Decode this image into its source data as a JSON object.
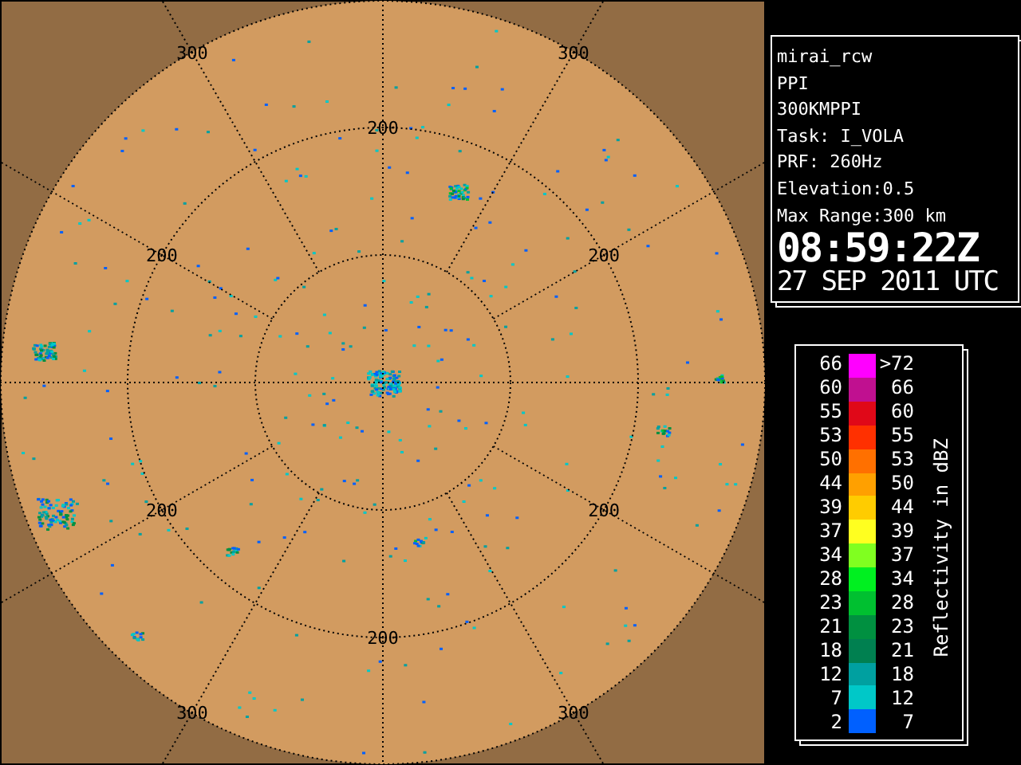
{
  "radar": {
    "ring_200_labels": [
      "200",
      "200",
      "200",
      "200",
      "200",
      "200"
    ],
    "ring_300_labels": [
      "300",
      "300",
      "300",
      "300"
    ]
  },
  "info": {
    "lines": [
      "mirai_rcw",
      "PPI",
      "300KMPPI",
      "Task: I_VOLA",
      "PRF: 260Hz",
      "Elevation:0.5",
      "Max Range:300 km"
    ],
    "time": "08:59:22Z",
    "date": "27 SEP 2011 UTC"
  },
  "legend": {
    "title": "Reflectivity in dBZ",
    "bins": [
      {
        "low": "66",
        "high": ">72",
        "color": "#ff00ff"
      },
      {
        "low": "60",
        "high": "66",
        "color": "#c01090"
      },
      {
        "low": "55",
        "high": "60",
        "color": "#e00818"
      },
      {
        "low": "53",
        "high": "55",
        "color": "#ff3000"
      },
      {
        "low": "50",
        "high": "53",
        "color": "#ff7000"
      },
      {
        "low": "44",
        "high": "50",
        "color": "#ffa000"
      },
      {
        "low": "39",
        "high": "44",
        "color": "#ffcc00"
      },
      {
        "low": "37",
        "high": "39",
        "color": "#ffff20"
      },
      {
        "low": "34",
        "high": "37",
        "color": "#80ff20"
      },
      {
        "low": "28",
        "high": "34",
        "color": "#00f020"
      },
      {
        "low": "23",
        "high": "28",
        "color": "#00c030"
      },
      {
        "low": "21",
        "high": "23",
        "color": "#009040"
      },
      {
        "low": "18",
        "high": "21",
        "color": "#008050"
      },
      {
        "low": "12",
        "high": "18",
        "color": "#00a0a0"
      },
      {
        "low": "7",
        "high": "12",
        "color": "#00c8c8"
      },
      {
        "low": "2",
        "high": "7",
        "color": "#0060ff"
      }
    ]
  }
}
